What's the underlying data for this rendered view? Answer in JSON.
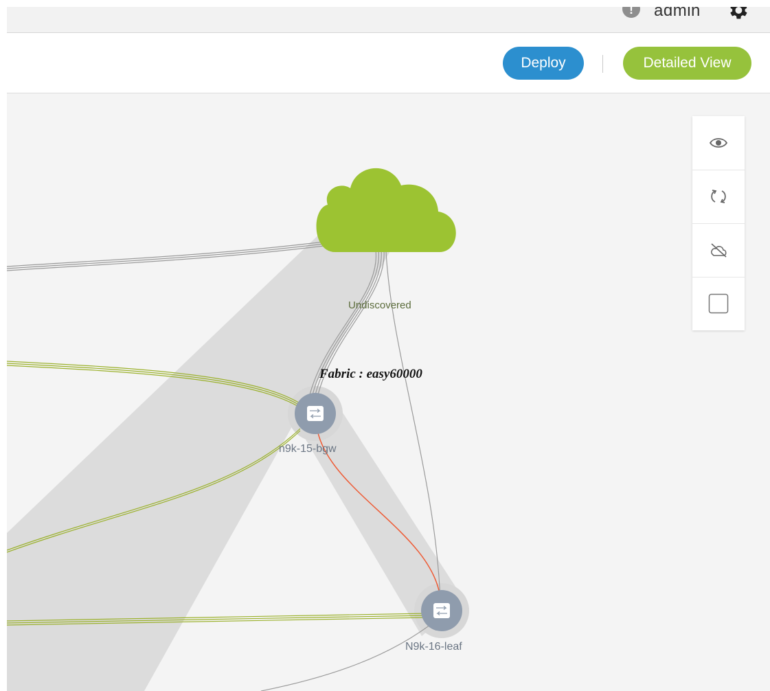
{
  "header": {
    "help_icon": "help-circle-icon",
    "help_glyph": "!",
    "user": "admin",
    "settings_icon": "gear-icon"
  },
  "toolbar": {
    "deploy_label": "Deploy",
    "detailed_view_label": "Detailed View",
    "deploy_color": "#2c8fcf",
    "detailed_view_color": "#96c23c"
  },
  "side_panel": {
    "buttons": [
      {
        "icon": "eye-icon"
      },
      {
        "icon": "refresh-icon"
      },
      {
        "icon": "cloud-off-icon"
      },
      {
        "icon": "checkbox-icon"
      }
    ]
  },
  "topology": {
    "fabric_label": "Fabric : easy60000",
    "cloud": {
      "label": "Undiscovered",
      "color": "#9cc332"
    },
    "nodes": [
      {
        "name": "n9k-15-bgw",
        "icon": "switch-icon"
      },
      {
        "name": "N9k-16-leaf",
        "icon": "switch-icon"
      }
    ],
    "link_colors": {
      "uplink": "#9bb12c",
      "error": "#ee5a34",
      "external": "#9a9a9a"
    }
  }
}
